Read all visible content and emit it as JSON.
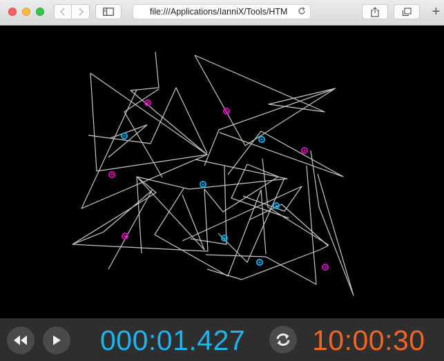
{
  "browser": {
    "url": "file:///Applications/IanniX/Tools/HTM",
    "new_tab_label": "+"
  },
  "transport": {
    "elapsed": "000:01.427",
    "total": "10:00:30",
    "elapsed_color": "#19b6f0",
    "total_color": "#f26522"
  },
  "score": {
    "background": "#000000",
    "curve_color": "#c8c8c8",
    "cursor_colors": {
      "cyan": "#00b4f0",
      "magenta": "#e600c8"
    }
  }
}
